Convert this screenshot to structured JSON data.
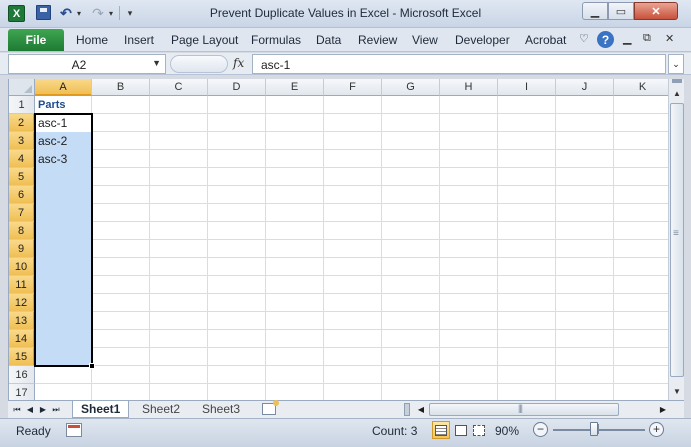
{
  "window": {
    "title": "Prevent Duplicate Values in Excel  -  Microsoft Excel",
    "min_glyph": "▁",
    "max_glyph": "▭",
    "close_glyph": "✕"
  },
  "ribbon": {
    "file_label": "File",
    "tabs": [
      "Home",
      "Insert",
      "Page Layout",
      "Formulas",
      "Data",
      "Review",
      "View",
      "Developer",
      "Acrobat"
    ],
    "help_glyph": "?"
  },
  "formula_bar": {
    "name_box": "A2",
    "fx_label": "fx",
    "formula": "asc-1"
  },
  "grid": {
    "columns": [
      "A",
      "B",
      "C",
      "D",
      "E",
      "F",
      "G",
      "H",
      "I",
      "J",
      "K"
    ],
    "rows": [
      "1",
      "2",
      "3",
      "4",
      "5",
      "6",
      "7",
      "8",
      "9",
      "10",
      "11",
      "12",
      "13",
      "14",
      "15",
      "16",
      "17"
    ],
    "cells": {
      "A1": "Parts",
      "A2": "asc-1",
      "A3": "asc-2",
      "A4": "asc-3"
    },
    "active_cell": "A2",
    "selection": "A2:A15"
  },
  "sheets": {
    "tabs": [
      "Sheet1",
      "Sheet2",
      "Sheet3"
    ],
    "active": "Sheet1"
  },
  "status_bar": {
    "ready": "Ready",
    "count": "Count: 3",
    "zoom": "90%"
  },
  "colors": {
    "selection_fill": "#c5dcf6",
    "header_highlight": "#f0bf54",
    "file_tab": "#2e8f45",
    "parts_header": "#1f4e8c"
  }
}
